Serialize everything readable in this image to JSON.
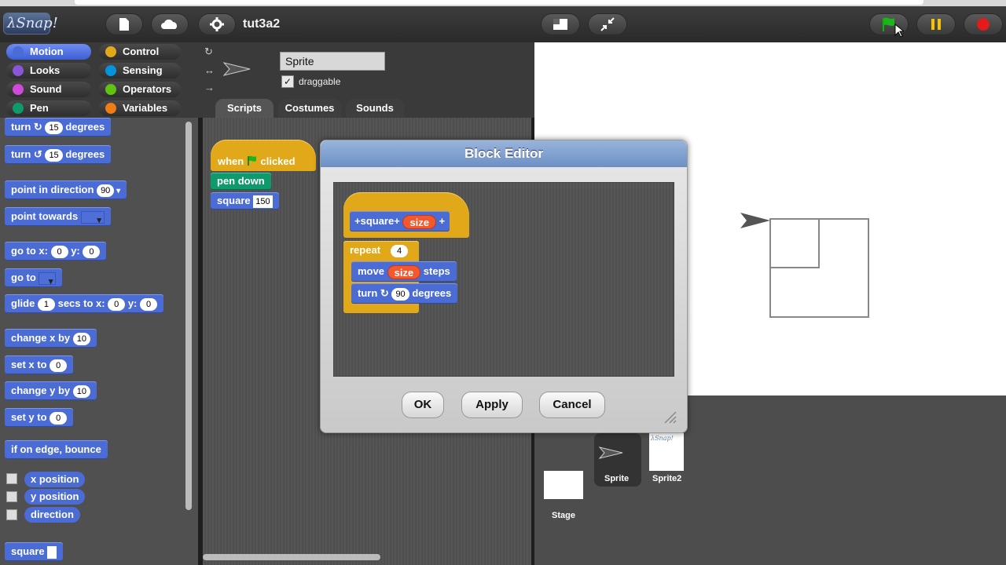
{
  "app": {
    "logo": "λSnap!",
    "project_name": "tut3a2"
  },
  "categories": [
    {
      "label": "Motion",
      "color": "#4a6cd4",
      "selected": true
    },
    {
      "label": "Control",
      "color": "#e1a91a",
      "selected": false
    },
    {
      "label": "Looks",
      "color": "#8a55d7",
      "selected": false
    },
    {
      "label": "Sensing",
      "color": "#0494dc",
      "selected": false
    },
    {
      "label": "Sound",
      "color": "#cf4ad9",
      "selected": false
    },
    {
      "label": "Operators",
      "color": "#62c213",
      "selected": false
    },
    {
      "label": "Pen",
      "color": "#0e9a6c",
      "selected": false
    },
    {
      "label": "Variables",
      "color": "#ee7d16",
      "selected": false
    }
  ],
  "palette": {
    "turn_cw": {
      "label": "turn",
      "value": "15",
      "suffix": "degrees"
    },
    "turn_ccw": {
      "label": "turn",
      "value": "15",
      "suffix": "degrees"
    },
    "point_dir": {
      "label": "point in direction",
      "value": "90"
    },
    "point_towards": {
      "label": "point towards"
    },
    "goto_xy": {
      "label": "go to x:",
      "x": "0",
      "ylabel": "y:",
      "y": "0"
    },
    "goto": {
      "label": "go to"
    },
    "glide": {
      "label": "glide",
      "secs": "1",
      "mid": "secs to x:",
      "x": "0",
      "ylabel": "y:",
      "y": "0"
    },
    "change_x": {
      "label": "change x by",
      "value": "10"
    },
    "set_x": {
      "label": "set x to",
      "value": "0"
    },
    "change_y": {
      "label": "change y by",
      "value": "10"
    },
    "set_y": {
      "label": "set y to",
      "value": "0"
    },
    "bounce": {
      "label": "if on edge, bounce"
    },
    "x_position": "x position",
    "y_position": "y position",
    "direction": "direction",
    "square": "square"
  },
  "sprite": {
    "name": "Sprite",
    "draggable_label": "draggable",
    "tabs": [
      "Scripts",
      "Costumes",
      "Sounds"
    ]
  },
  "script": {
    "hat_when": "when",
    "hat_clicked": "clicked",
    "pen_down": "pen down",
    "square_label": "square",
    "square_value": "150"
  },
  "dialog": {
    "title": "Block Editor",
    "proto_label": "square",
    "proto_param": "size",
    "repeat_label": "repeat",
    "repeat_value": "4",
    "move_label": "move",
    "move_param": "size",
    "move_suffix": "steps",
    "turn_label": "turn",
    "turn_value": "90",
    "turn_suffix": "degrees",
    "ok": "OK",
    "apply": "Apply",
    "cancel": "Cancel"
  },
  "corral": {
    "stage_label": "Stage",
    "sprites": [
      "Sprite",
      "Sprite2"
    ],
    "sprite2_thumb_text": "λSnap!"
  }
}
